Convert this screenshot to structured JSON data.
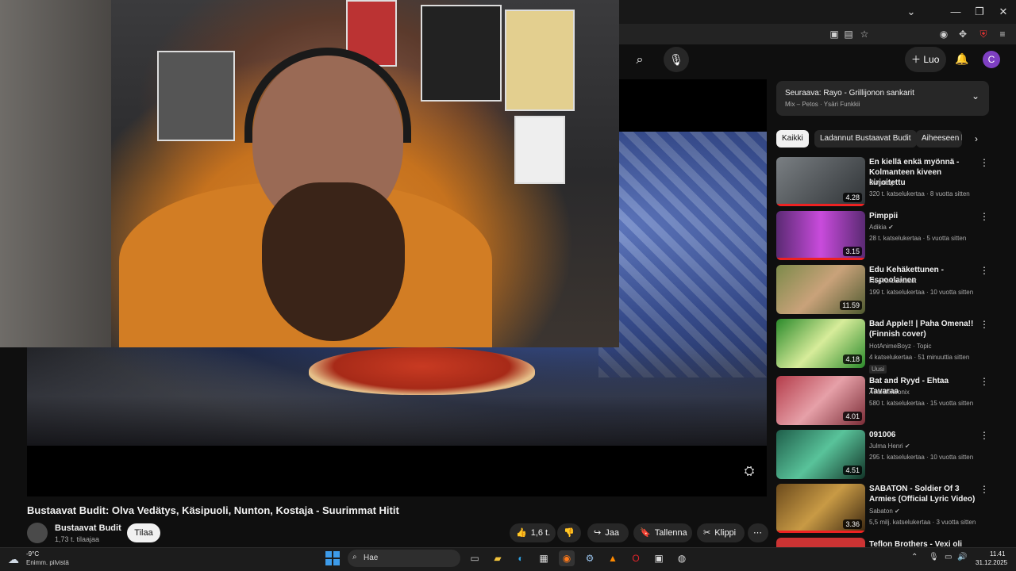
{
  "browser": {
    "window_controls": [
      "⌄",
      "—",
      "❐",
      "✕"
    ],
    "toolbar_icons": [
      "picture-in-picture-icon",
      "save-page-icon",
      "bookmark-star-icon",
      "profile-icon",
      "extensions-icon",
      "ublock-icon",
      "menu-icon"
    ]
  },
  "header": {
    "create_label": "Luo",
    "avatar_letter": "C"
  },
  "video": {
    "title": "Bustaavat Budit: Olva Vedätys, Käsipuoli, Nunton, Kostaja - Suurimmat Hitit",
    "channel": "Bustaavat Budit",
    "subscribers": "1,73 t. tilaajaa",
    "subscribe_label": "Tilaa",
    "likes": "1,6 t.",
    "share_label": "Jaa",
    "save_label": "Tallenna",
    "clip_label": "Klippi"
  },
  "up_next": {
    "title": "Seuraava: Rayo - Grillijonon sankarit",
    "subtitle": "Mix – Petos · Ysäri Funkkii"
  },
  "chips": [
    "Kaikki",
    "Ladannut Bustaavat Budit",
    "Aiheeseen liittyvät"
  ],
  "recommendations": [
    {
      "title": "En kiellä enkä myönnä - Kolmanteen kiveen kirjoitettu",
      "channel": "Överdog",
      "verified": false,
      "meta": "320 t. katselukertaa · 8 vuotta sitten",
      "duration": "4.28",
      "badge": ""
    },
    {
      "title": "Pimppii",
      "channel": "Adikia",
      "verified": true,
      "meta": "28 t. katselukertaa · 5 vuotta sitten",
      "duration": "3.15",
      "badge": ""
    },
    {
      "title": "Edu Kehäkettunen - Espoolainen",
      "channel": "FlopToriJulkaisut",
      "verified": false,
      "meta": "199 t. katselukertaa · 10 vuotta sitten",
      "duration": "11.59",
      "badge": ""
    },
    {
      "title": "Bad Apple!! | Paha Omena!! (Finnish cover)",
      "channel": "HotAnimeBoyz · Topic",
      "verified": false,
      "meta": "4 katselukertaa · 51 minuuttia sitten",
      "duration": "4.18",
      "badge": "Uusi"
    },
    {
      "title": "Bat and Ryyd - Ehtaa Tavaraa",
      "channel": "Ambidextronix",
      "verified": false,
      "meta": "580 t. katselukertaa · 15 vuotta sitten",
      "duration": "4.01",
      "badge": ""
    },
    {
      "title": "091006",
      "channel": "Julma Henri",
      "verified": true,
      "meta": "295 t. katselukertaa · 10 vuotta sitten",
      "duration": "4.51",
      "badge": ""
    },
    {
      "title": "SABATON - Soldier Of 3 Armies (Official Lyric Video)",
      "channel": "Sabaton",
      "verified": true,
      "meta": "5,5 milj. katselukertaa · 3 vuotta sitten",
      "duration": "3.36",
      "badge": ""
    },
    {
      "title": "Teflon Brothers - Vexi oli valkea",
      "channel": "",
      "verified": false,
      "meta": "",
      "duration": "",
      "badge": ""
    }
  ],
  "taskbar": {
    "weather_temp": "-9°C",
    "weather_desc": "Enimm. pilvistä",
    "search_placeholder": "Hae",
    "time": "11.41",
    "date": "31.12.2025"
  }
}
